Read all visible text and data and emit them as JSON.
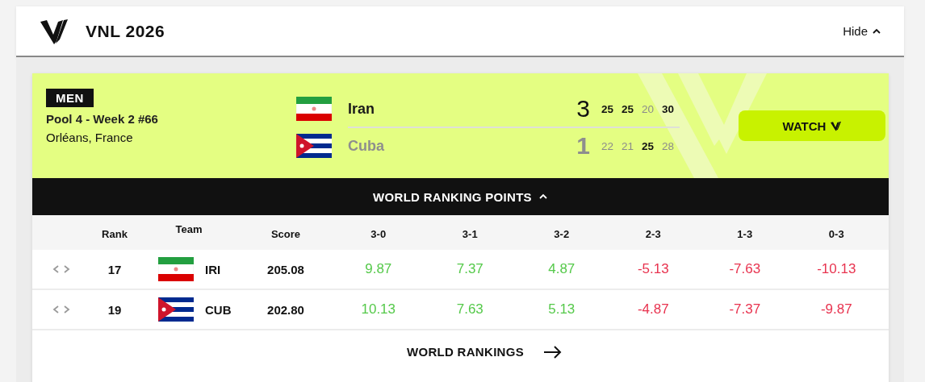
{
  "header": {
    "title": "VNL 2026",
    "toggle": "Hide"
  },
  "match": {
    "category": "MEN",
    "pool": "Pool 4 - Week 2 #66",
    "venue": "Orléans, France",
    "teams": [
      {
        "name": "Iran",
        "winner": true,
        "sets_won": "3",
        "sets": [
          {
            "points": "25",
            "won": true
          },
          {
            "points": "25",
            "won": true
          },
          {
            "points": "20",
            "won": false
          },
          {
            "points": "30",
            "won": true
          }
        ]
      },
      {
        "name": "Cuba",
        "winner": false,
        "sets_won": "1",
        "sets": [
          {
            "points": "22",
            "won": false
          },
          {
            "points": "21",
            "won": false
          },
          {
            "points": "25",
            "won": true
          },
          {
            "points": "28",
            "won": false
          }
        ]
      }
    ],
    "watch_button": "WATCH"
  },
  "ranking": {
    "title": "WORLD RANKING POINTS",
    "expanded": true,
    "columns": [
      "Rank",
      "Team",
      "Score",
      "3-0",
      "3-1",
      "3-2",
      "2-3",
      "1-3",
      "0-3"
    ],
    "rows": [
      {
        "rank": "17",
        "team": "IRI",
        "score": "205.08",
        "points": [
          {
            "value": "9.87",
            "kind": "gain"
          },
          {
            "value": "7.37",
            "kind": "gain"
          },
          {
            "value": "4.87",
            "kind": "gain"
          },
          {
            "value": "-5.13",
            "kind": "loss"
          },
          {
            "value": "-7.63",
            "kind": "loss"
          },
          {
            "value": "-10.13",
            "kind": "loss"
          }
        ]
      },
      {
        "rank": "19",
        "team": "CUB",
        "score": "202.80",
        "points": [
          {
            "value": "10.13",
            "kind": "gain"
          },
          {
            "value": "7.63",
            "kind": "gain"
          },
          {
            "value": "5.13",
            "kind": "gain"
          },
          {
            "value": "-4.87",
            "kind": "loss"
          },
          {
            "value": "-7.37",
            "kind": "loss"
          },
          {
            "value": "-9.87",
            "kind": "loss"
          }
        ]
      }
    ],
    "link": "WORLD RANKINGS"
  }
}
